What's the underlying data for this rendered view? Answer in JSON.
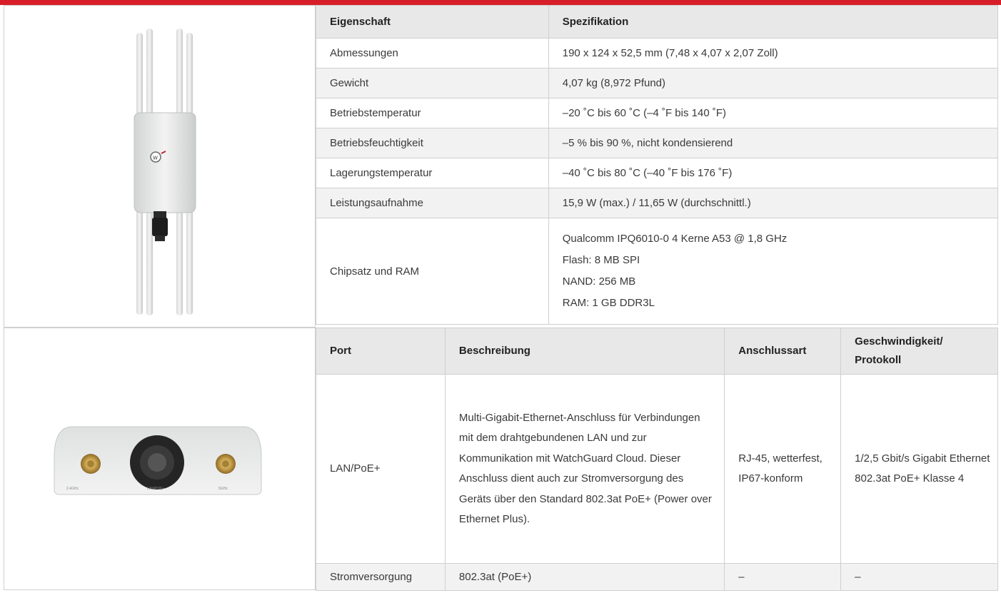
{
  "spec_table": {
    "header": {
      "property": "Eigenschaft",
      "value": "Spezifikation"
    },
    "rows": [
      {
        "property": "Abmessungen",
        "value": "190 x 124 x 52,5 mm (7,48 x 4,07 x 2,07 Zoll)"
      },
      {
        "property": "Gewicht",
        "value": "4,07 kg (8,972 Pfund)"
      },
      {
        "property": "Betriebstemperatur",
        "value": "–20 ˚C bis 60 ˚C (–4 ˚F bis 140 ˚F)"
      },
      {
        "property": "Betriebsfeuchtigkeit",
        "value": "–5 % bis 90 %, nicht kondensierend"
      },
      {
        "property": "Lagerungstemperatur",
        "value": "–40 ˚C bis 80 ˚C (–40 ˚F bis 176 ˚F)"
      },
      {
        "property": "Leistungsaufnahme",
        "value": "15,9 W (max.) / 11,65 W (durchschnittl.)"
      }
    ],
    "chipset": {
      "property": "Chipsatz und RAM",
      "lines": [
        "Qualcomm IPQ6010-0 4 Kerne A53 @ 1,8 GHz",
        "Flash: 8 MB SPI",
        "NAND: 256 MB",
        "RAM: 1 GB DDR3L"
      ]
    }
  },
  "port_table": {
    "headers": {
      "port": "Port",
      "description": "Beschreibung",
      "connector": "Anschlussart",
      "speed_line1": "Geschwindigkeit/",
      "speed_line2": "Protokoll"
    },
    "lan": {
      "port": "LAN/PoE+",
      "description": "Multi-Gigabit-Ethernet-Anschluss für Verbindungen mit dem drahtgebundenen LAN und zur Kommunikation mit WatchGuard Cloud. Dieser Anschluss dient auch zur Stromversorgung des Geräts über den Standard 802.3at PoE+ (Power over Ethernet Plus).",
      "connector": "RJ-45, wetterfest, IP67-konform",
      "speed": "1/2,5 Gbit/s Gigabit Ethernet 802.3at PoE+ Klasse 4"
    },
    "power": {
      "port": "Stromversorgung",
      "description": "802.3at (PoE+)",
      "connector": "–",
      "speed": "–"
    }
  },
  "device_labels": {
    "antenna_left": "2.4GHz",
    "center": "LAN/POE+",
    "antenna_right": "5GHz"
  },
  "colors": {
    "accent_bar": "#d71e28",
    "header_bg": "#e8e8e8",
    "shade_bg": "#f2f2f2",
    "border": "#cfcfcf"
  }
}
